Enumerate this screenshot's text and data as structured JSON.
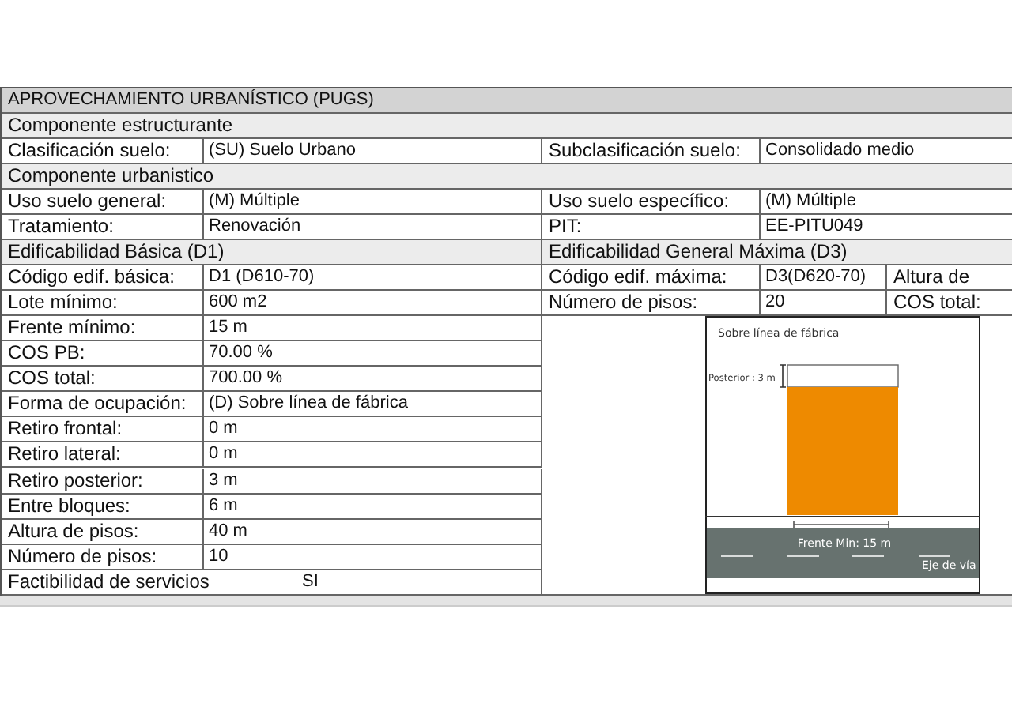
{
  "title": "APROVECHAMIENTO URBANÍSTICO (PUGS)",
  "rows": [
    {
      "kind": "section",
      "text": "Componente  estructurante"
    },
    {
      "kind": "pair",
      "cells": [
        "Clasificación suelo:",
        "(SU) Suelo Urbano",
        "Subclasificación suelo:",
        "Consolidado medio"
      ]
    },
    {
      "kind": "section",
      "text": "Componente  urbanistico"
    },
    {
      "kind": "pair",
      "cells": [
        "Uso suelo general:",
        "(M) Múltiple",
        "Uso suelo específico:",
        "(M) Múltiple"
      ]
    },
    {
      "kind": "pair",
      "cells": [
        "Tratamiento:",
        "Renovación",
        "PIT:",
        "EE-PITU049"
      ]
    },
    {
      "kind": "split",
      "cells": [
        "Edificabilidad Básica (D1)",
        "Edificabilidad General Máxima (D3)"
      ]
    },
    {
      "kind": "pair",
      "cells": [
        "Código edif. básica:",
        "D1 (D610-70)",
        "Código edif. máxima:",
        "D3(D620-70)",
        "Altura de"
      ]
    },
    {
      "kind": "pair",
      "cells": [
        "Lote mínimo:",
        "600 m2",
        "Número de pisos:",
        "20",
        "COS total:"
      ]
    }
  ],
  "left_rows": [
    {
      "kind": "field",
      "label": "Frente mínimo:",
      "value": "15 m"
    },
    {
      "kind": "field",
      "label": "COS PB:",
      "value": "70.00 %"
    },
    {
      "kind": "field",
      "label": "COS total:",
      "value": "700.00 %"
    },
    {
      "kind": "field",
      "label": "Forma de ocupación:",
      "value": "(D) Sobre línea de fábrica"
    },
    {
      "kind": "field",
      "label": "Retiro frontal:",
      "value": "0 m"
    },
    {
      "kind": "field",
      "label": "Retiro lateral:",
      "value": "0 m"
    },
    {
      "kind": "field",
      "label": "Retiro posterior:",
      "value": "3 m"
    },
    {
      "kind": "field",
      "label": "Entre bloques:",
      "value": "6 m"
    },
    {
      "kind": "field",
      "label": "Altura de pisos:",
      "value": "40 m"
    },
    {
      "kind": "field",
      "label": "Número de pisos:",
      "value": "10"
    },
    {
      "kind": "wide",
      "label": "Factibilidad de servicios",
      "value": "SI"
    }
  ],
  "diagram": {
    "title": "Sobre línea de fábrica",
    "rear_label": "Posterior : 3 m",
    "front_label": "Frente Min: 15 m",
    "axis_label": "Eje de vía"
  }
}
